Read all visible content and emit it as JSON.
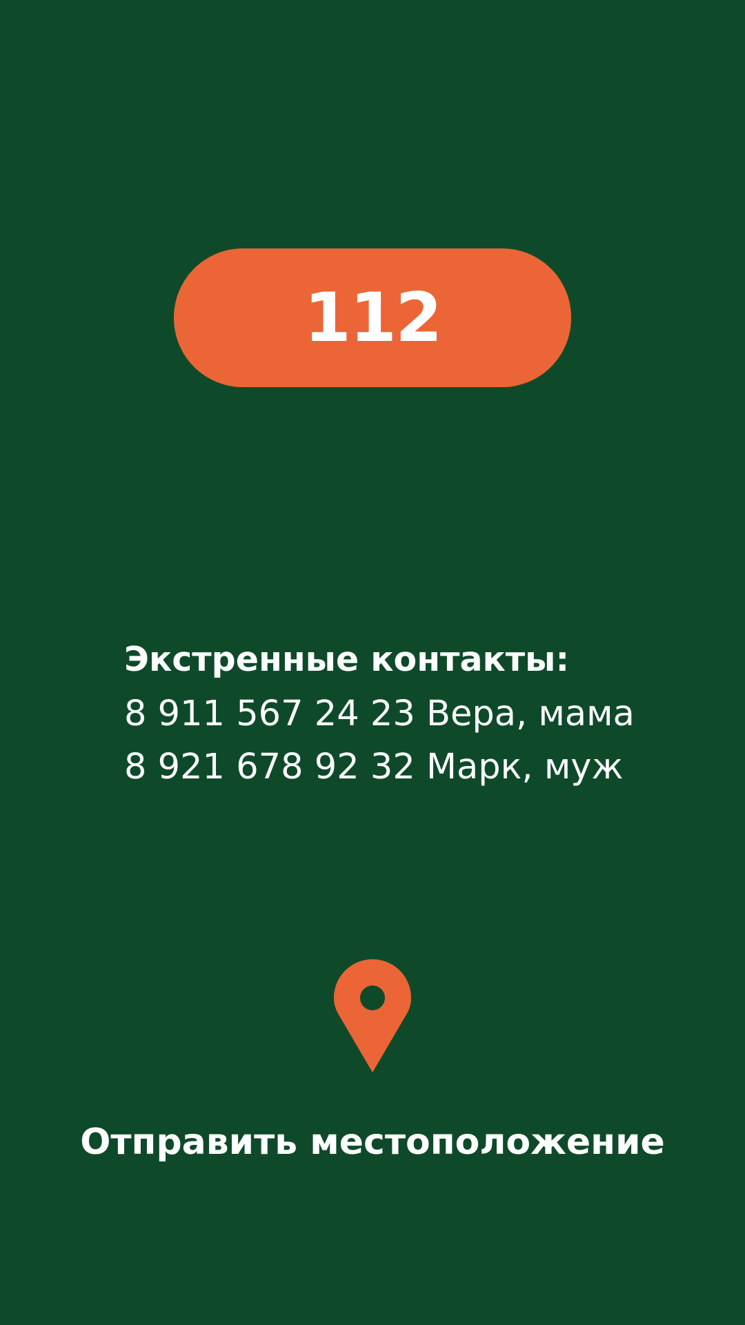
{
  "colors": {
    "background": "#0e4a2a",
    "accent": "#ec6536",
    "text": "#ffffff"
  },
  "emergency": {
    "number": "112"
  },
  "contacts": {
    "title": "Экстренные контакты:",
    "items": [
      "8 911 567 24 23 Вера, мама",
      "8 921 678 92 32 Марк, муж"
    ]
  },
  "location": {
    "icon": "map-pin-icon",
    "label": "Отправить местоположение"
  }
}
